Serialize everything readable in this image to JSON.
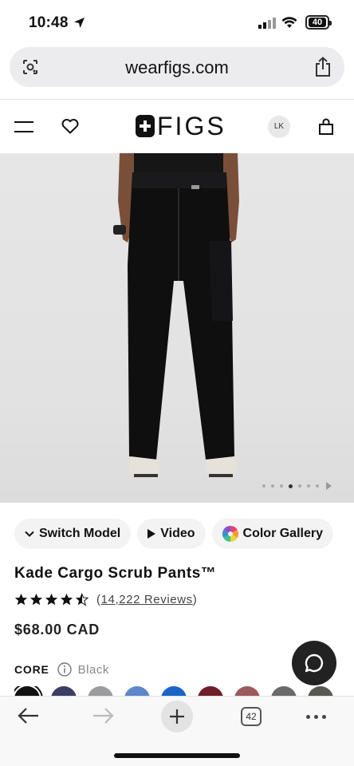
{
  "status_bar": {
    "time": "10:48",
    "battery": "40"
  },
  "browser": {
    "url": "wearfigs.com",
    "open_tabs": "42"
  },
  "site_header": {
    "logo": "FIGS",
    "avatar_initials": "LK"
  },
  "hero": {
    "slide_count": 7,
    "active_slide": 4
  },
  "chips": [
    {
      "label": "Switch Model",
      "icon": "chevron-down-icon"
    },
    {
      "label": "Video",
      "icon": "play-icon"
    },
    {
      "label": "Color Gallery",
      "icon": "color-wheel-icon"
    }
  ],
  "product": {
    "title": "Kade Cargo Scrub Pants™",
    "rating": 4.5,
    "reviews_count": "14,222 Reviews",
    "reviews_open": "(",
    "reviews_close": ")",
    "price": "$68.00 CAD",
    "collection_label": "CORE",
    "selected_color": "Black"
  },
  "swatch_colors": [
    "#111111",
    "#3a3d66",
    "#9b9ca0",
    "#5f86c9",
    "#1b64c8",
    "#6e1f2a",
    "#9a5a5e",
    "#6a6a6a",
    "#58584e"
  ],
  "colors": {
    "accent": "#111111",
    "chip_bg": "#f3f3f3"
  }
}
